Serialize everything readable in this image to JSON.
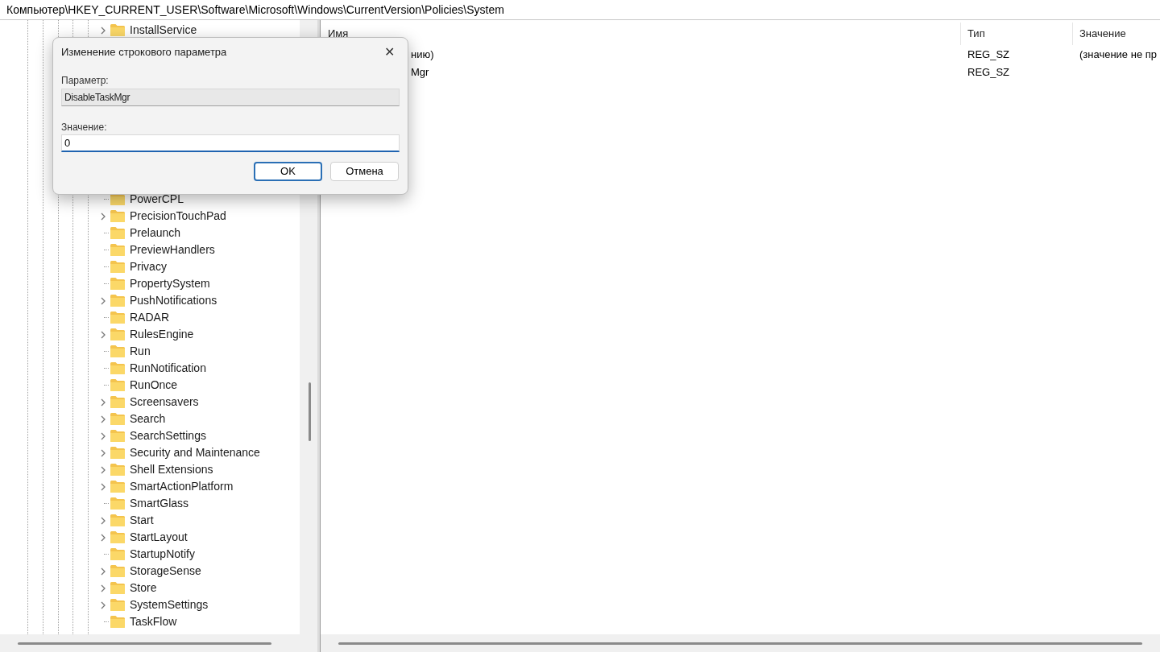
{
  "address_bar": {
    "path": "Компьютер\\HKEY_CURRENT_USER\\Software\\Microsoft\\Windows\\CurrentVersion\\Policies\\System"
  },
  "tree": {
    "items_before_dialog": [
      {
        "label": "InstallService",
        "expandable": true
      }
    ],
    "items_after_dialog": [
      {
        "label": "PowerCPL",
        "expandable": false
      },
      {
        "label": "PrecisionTouchPad",
        "expandable": true
      },
      {
        "label": "Prelaunch",
        "expandable": false
      },
      {
        "label": "PreviewHandlers",
        "expandable": false
      },
      {
        "label": "Privacy",
        "expandable": false
      },
      {
        "label": "PropertySystem",
        "expandable": false
      },
      {
        "label": "PushNotifications",
        "expandable": true
      },
      {
        "label": "RADAR",
        "expandable": false
      },
      {
        "label": "RulesEngine",
        "expandable": true
      },
      {
        "label": "Run",
        "expandable": false
      },
      {
        "label": "RunNotification",
        "expandable": false
      },
      {
        "label": "RunOnce",
        "expandable": false
      },
      {
        "label": "Screensavers",
        "expandable": true
      },
      {
        "label": "Search",
        "expandable": true
      },
      {
        "label": "SearchSettings",
        "expandable": true
      },
      {
        "label": "Security and Maintenance",
        "expandable": true
      },
      {
        "label": "Shell Extensions",
        "expandable": true
      },
      {
        "label": "SmartActionPlatform",
        "expandable": true
      },
      {
        "label": "SmartGlass",
        "expandable": false
      },
      {
        "label": "Start",
        "expandable": true
      },
      {
        "label": "StartLayout",
        "expandable": true
      },
      {
        "label": "StartupNotify",
        "expandable": false
      },
      {
        "label": "StorageSense",
        "expandable": true
      },
      {
        "label": "Store",
        "expandable": true
      },
      {
        "label": "SystemSettings",
        "expandable": true
      },
      {
        "label": "TaskFlow",
        "expandable": false
      }
    ]
  },
  "values_table": {
    "columns": [
      "Имя",
      "Тип",
      "Значение"
    ],
    "rows": [
      {
        "name": "нию)",
        "type": "REG_SZ",
        "value": "(значение не пр"
      },
      {
        "name": "Mgr",
        "type": "REG_SZ"
      }
    ]
  },
  "dialog": {
    "title": "Изменение строкового параметра",
    "close": "✕",
    "name_label": "Параметр:",
    "name_value": "DisableTaskMgr",
    "value_label": "Значение:",
    "value": "0",
    "buttons": [
      {
        "label": "OK",
        "default": true
      },
      {
        "label": "Отмена",
        "default": false
      }
    ]
  }
}
